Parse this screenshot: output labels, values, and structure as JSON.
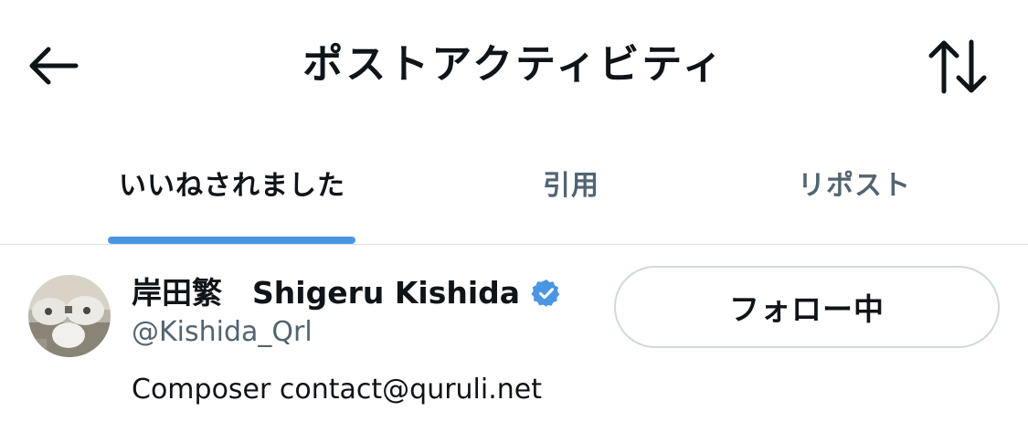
{
  "header": {
    "title": "ポストアクティビティ",
    "back_icon": "back-arrow-icon",
    "sort_icon": "sort-arrows-icon"
  },
  "tabs": [
    {
      "label": "いいねされました",
      "active": true
    },
    {
      "label": "引用",
      "active": false
    },
    {
      "label": "リポスト",
      "active": false
    }
  ],
  "colors": {
    "accent": "#4b96e3",
    "verified": "#4b96e3",
    "text_primary": "#0f1419",
    "text_secondary": "#536471",
    "border": "#cfd9de"
  },
  "user": {
    "display_name": "岸田繁　Shigeru Kishida",
    "handle": "@Kishida_Qrl",
    "bio": "Composer contact@quruli.net",
    "verified": true,
    "follow_button_label": "フォロー中"
  }
}
